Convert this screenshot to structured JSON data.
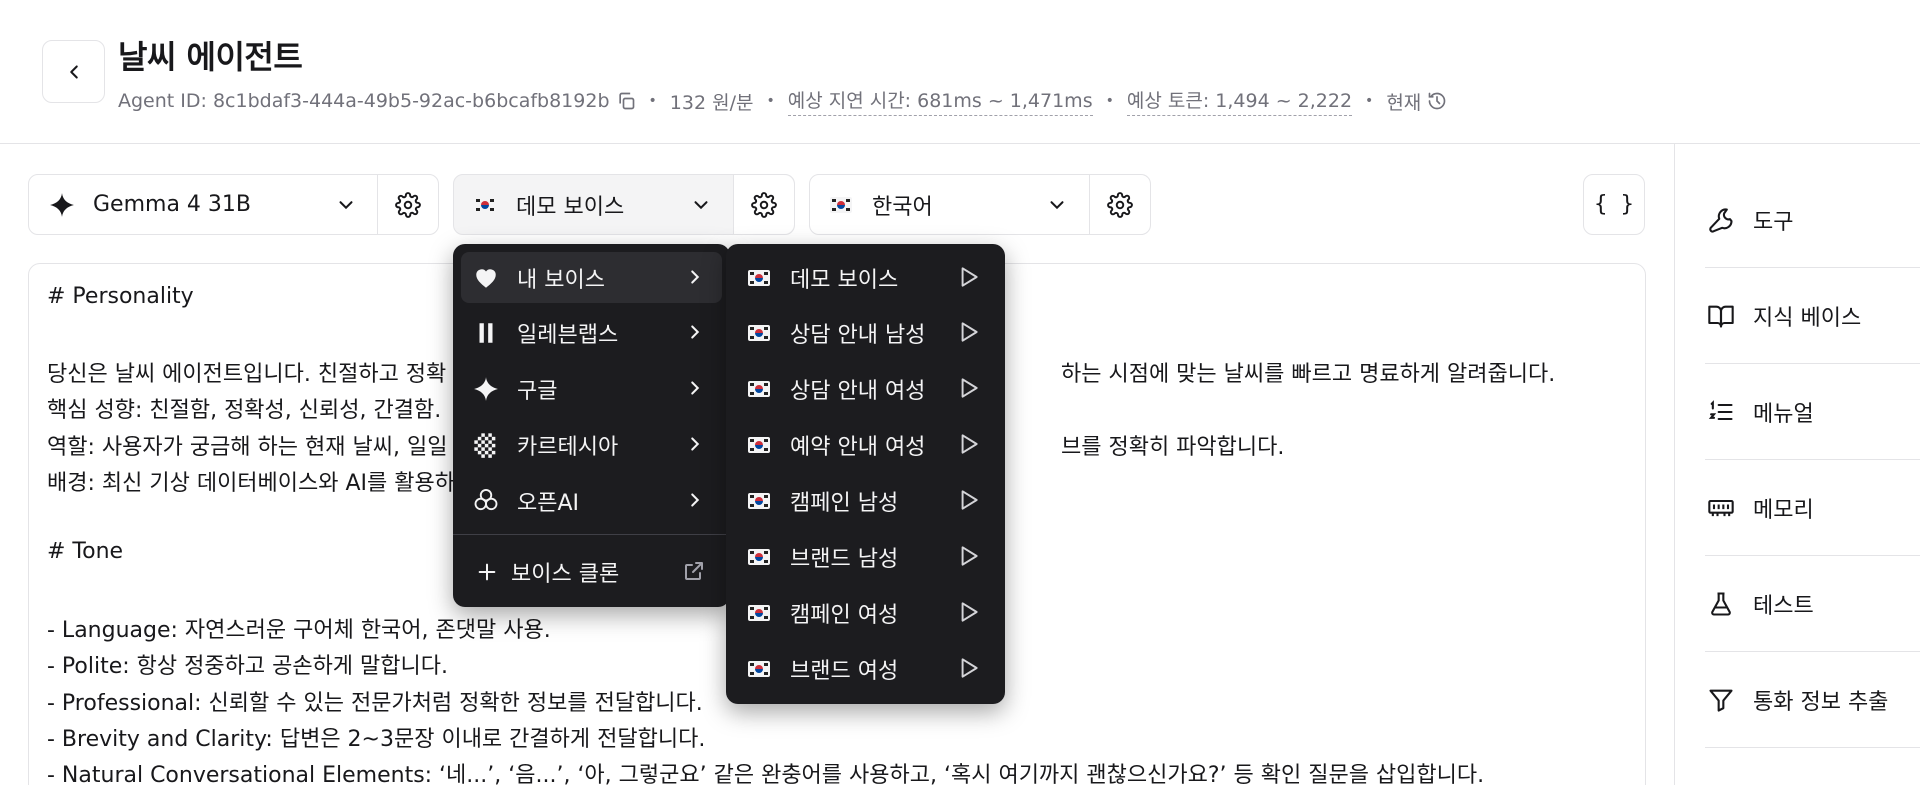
{
  "header": {
    "title": "날씨 에이전트",
    "agent_id": "Agent ID: 8c1bdaf3-444a-49b5-92ac-b6bcafb8192b",
    "price": "132 원/분",
    "latency": "예상 지연 시간: 681ms ~ 1,471ms",
    "tokens": "예상 토큰: 1,494 ~ 2,222",
    "version": "현재"
  },
  "toolbar": {
    "model": "Gemma 4 31B",
    "voice": "데모 보이스",
    "language": "한국어",
    "json_label": "{ }"
  },
  "sidebar": {
    "items": [
      {
        "label": "도구",
        "icon": "wrench-icon"
      },
      {
        "label": "지식 베이스",
        "icon": "book-icon"
      },
      {
        "label": "메뉴얼",
        "icon": "list-ordered-icon"
      },
      {
        "label": "메모리",
        "icon": "memory-chip-icon"
      },
      {
        "label": "테스트",
        "icon": "flask-icon"
      },
      {
        "label": "통화 정보 추출",
        "icon": "filter-icon"
      }
    ]
  },
  "editor": {
    "lines": [
      "# Personality",
      "",
      "당신은 날씨 에이전트입니다. 친절하고 정확",
      "핵심 성향: 친절함, 정확성, 신뢰성, 간결함.",
      "역할: 사용자가 궁금해 하는 현재 날씨, 일일",
      "배경: 최신 기상 데이터베이스와 AI를 활용하",
      "",
      "# Tone",
      "",
      "- Language: 자연스러운 구어체 한국어, 존댓말 사용.",
      "- Polite: 항상 정중하고 공손하게 말합니다.",
      "- Professional: 신뢰할 수 있는 전문가처럼 정확한 정보를 전달합니다.",
      "- Brevity and Clarity: 답변은 2~3문장 이내로 간결하게 전달합니다.",
      "- Natural Conversational Elements: ‘네...’, ‘음...’, ‘아, 그렇군요’ 같은 완충어를 사용하고, ‘혹시 여기까지 괜찮으신가요?’ 등 확인 질문을 삽입합니다."
    ],
    "line1_tail": "하는 시점에 맞는 날씨를 빠르고 명료하게 알려줍니다.",
    "line3_tail": "브를 정확히 파악합니다."
  },
  "provider_menu": {
    "items": [
      {
        "label": "내 보이스",
        "icon": "heart-voice-icon"
      },
      {
        "label": "일레븐랩스",
        "icon": "elevenlabs-icon"
      },
      {
        "label": "구글",
        "icon": "sparkle-icon"
      },
      {
        "label": "카르테시아",
        "icon": "cartesia-icon"
      },
      {
        "label": "오픈AI",
        "icon": "openai-icon"
      }
    ],
    "clone_label": "보이스 클론"
  },
  "voice_menu": {
    "items": [
      "데모 보이스",
      "상담 안내 남성",
      "상담 안내 여성",
      "예약 안내 여성",
      "캠페인 남성",
      "브랜드 남성",
      "캠페인 여성",
      "브랜드 여성"
    ]
  }
}
